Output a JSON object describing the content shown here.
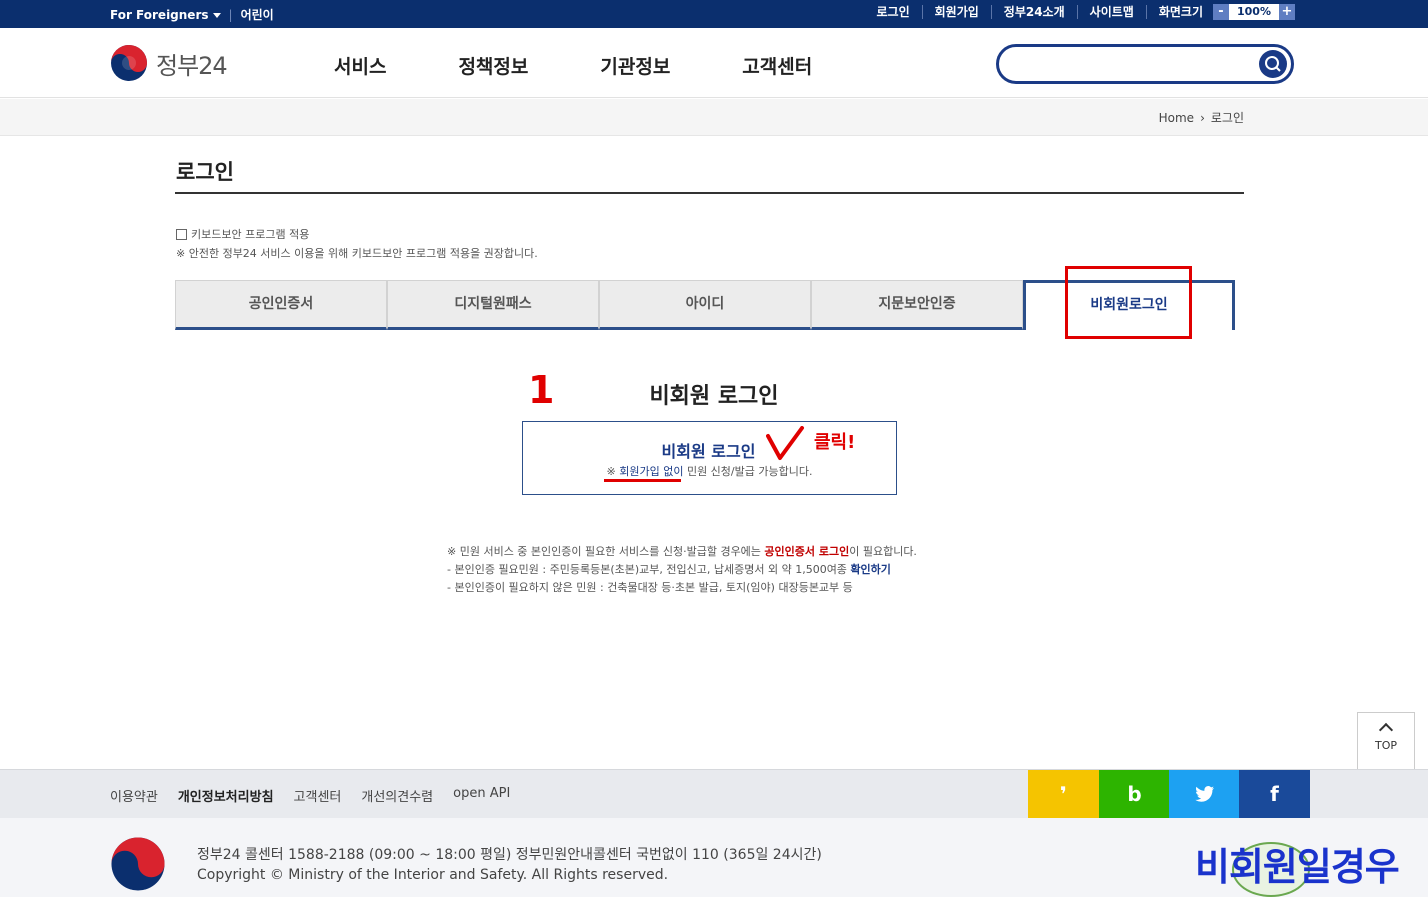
{
  "topbar": {
    "foreigners": "For Foreigners",
    "kids": "어린이",
    "links": [
      "로그인",
      "회원가입",
      "정부24소개",
      "사이트맵"
    ],
    "zoom_label": "화면크기",
    "zoom_minus": "-",
    "zoom_value": "100%",
    "zoom_plus": "+"
  },
  "header": {
    "logo_text": "정부24",
    "nav": [
      "서비스",
      "정책정보",
      "기관정보",
      "고객센터"
    ],
    "search_placeholder": ""
  },
  "breadcrumb": {
    "home": "Home",
    "current": "로그인"
  },
  "page": {
    "title": "로그인",
    "keyboard_label": "키보드보안 프로그램 적용",
    "keyboard_note": "※ 안전한 정부24 서비스 이용을 위해 키보드보안 프로그램 적용을 권장합니다."
  },
  "tabs": [
    "공인인증서",
    "디지털원패스",
    "아이디",
    "지문보안인증",
    "비회원로그인"
  ],
  "guest": {
    "section_title": "비회원 로그인",
    "button_label": "비회원 로그인",
    "note_prefix": "※ ",
    "note_link": "회원가입 없이",
    "note_rest": " 민원 신청/발급 가능합니다."
  },
  "annotations": {
    "step_number": "1",
    "click_text": "클릭!",
    "overlay_caption": "비회원일경우"
  },
  "info": {
    "line1_a": "※ 민원 서비스 중 본인인증이 필요한 서비스를 신청·발급할 경우에는 ",
    "line1_red": "공인인증서 로그인",
    "line1_b": "이 필요합니다.",
    "line2_a": "-  본인인증 필요민원 : 주민등록등본(초본)교부, 전입신고, 납세증명서 외 약 1,500여종 ",
    "line2_link": "확인하기",
    "line3": "-  본인인증이 필요하지 않은 민원 : 건축물대장 등·초본 발급, 토지(임야) 대장등본교부 등"
  },
  "top_button": "TOP",
  "footer": {
    "links": [
      "이용약관",
      "개인정보처리방침",
      "고객센터",
      "개선의견수렴",
      "open API"
    ],
    "sns": [
      "카카오스토리",
      "밴드",
      "트위터",
      "페이스북"
    ],
    "sns_glyphs": [
      "❜",
      "b",
      "",
      "f"
    ],
    "line1": "정부24 콜센터 1588-2188 (09:00 ~ 18:00 평일) 정부민원안내콜센터 국번없이 110 (365일 24시간)",
    "line2": "Copyright © Ministry of the Interior and Safety. All Rights reserved."
  },
  "colors": {
    "navy": "#0b2f6e",
    "accent": "#1a3a86",
    "red": "#e00000"
  }
}
